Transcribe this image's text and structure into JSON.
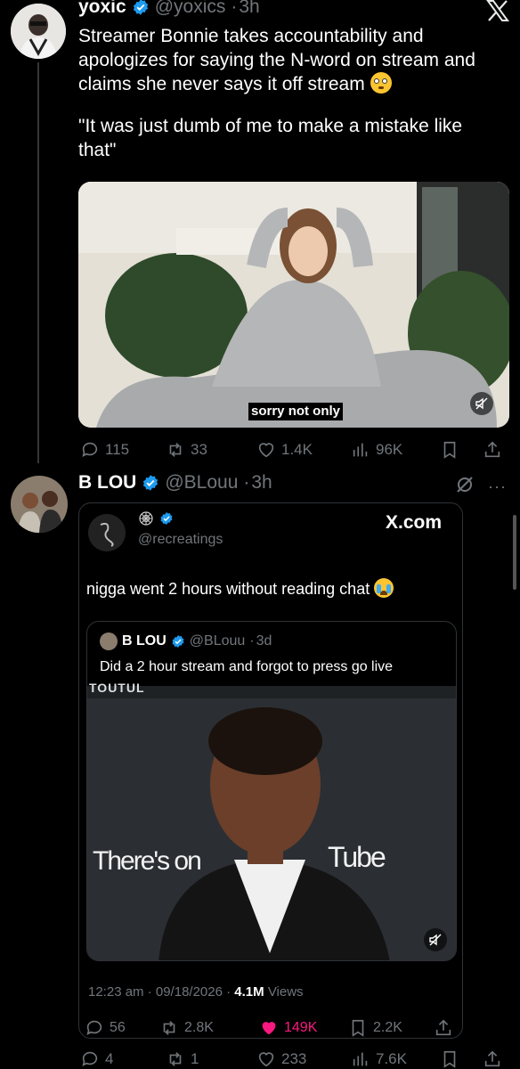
{
  "tweet1": {
    "name": "yoxic",
    "handle": "@yoxics",
    "time": "3h",
    "text_line1": "Streamer Bonnie takes accountability and",
    "text_line2": "apologizes for saying the N-word on stream and",
    "text_line3": "claims she never says it off stream",
    "quote_line1": "\"It was just dumb of me to make a mistake like",
    "quote_line2": "that\"",
    "caption": "sorry not only",
    "replies": "115",
    "reposts": "33",
    "likes": "1.4K",
    "views": "96K"
  },
  "tweet2": {
    "name": "B LOU",
    "handle": "@BLouu",
    "time": "3h",
    "embed": {
      "handle": "@recreatings",
      "brand": "X.com",
      "text": "nigga went 2 hours without reading chat",
      "quoted": {
        "name": "B LOU",
        "handle": "@BLouu",
        "time": "3d",
        "text": "Did a 2 hour stream and forgot to press go live",
        "image_text_left": "There's on",
        "image_text_right": "Tube",
        "image_text_top": "TOUTUL"
      },
      "timestamp": "12:23 am · 09/18/2026 ·",
      "views_count": "4.1M",
      "views_label": "Views",
      "replies": "56",
      "reposts": "2.8K",
      "likes": "149K",
      "bookmarks": "2.2K"
    },
    "replies": "4",
    "reposts": "1",
    "likes": "233",
    "views": "7.6K"
  },
  "colors": {
    "accent": "#1d9bf0",
    "like_active": "#f91880",
    "muted": "#71767b"
  }
}
